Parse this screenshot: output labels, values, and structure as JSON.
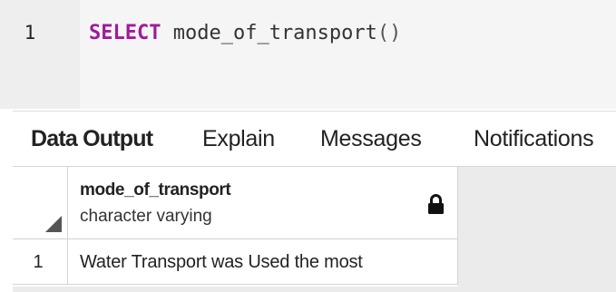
{
  "editor": {
    "line_number": "1",
    "keyword": "SELECT",
    "function_name": "mode_of_transport",
    "parens": "()"
  },
  "tabs": [
    {
      "label": "Data Output",
      "active": true
    },
    {
      "label": "Explain",
      "active": false
    },
    {
      "label": "Messages",
      "active": false
    },
    {
      "label": "Notifications",
      "active": false
    }
  ],
  "results": {
    "columns": [
      {
        "name": "mode_of_transport",
        "type": "character varying",
        "icon": "lock-icon"
      }
    ],
    "rows": [
      {
        "row_number": "1",
        "values": [
          "Water Transport was Used the most"
        ]
      }
    ]
  }
}
